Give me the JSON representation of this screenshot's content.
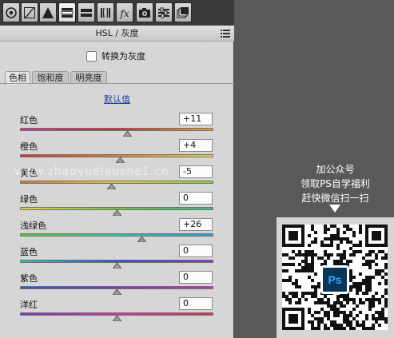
{
  "toolbar": {
    "tools": [
      {
        "icon": "basic-adjust-icon"
      },
      {
        "icon": "tone-curve-icon"
      },
      {
        "icon": "detail-sharpen-icon"
      },
      {
        "icon": "hsl-icon"
      },
      {
        "icon": "split-toning-icon"
      },
      {
        "icon": "lens-correction-icon"
      },
      {
        "icon": "effects-fx-icon",
        "glyph": "fx"
      },
      {
        "icon": "camera-calibration-icon"
      },
      {
        "icon": "presets-icon"
      },
      {
        "icon": "snapshots-icon"
      }
    ],
    "active_index": 3
  },
  "panel": {
    "title": "HSL / 灰度",
    "convert_gray_label": "转换为灰度",
    "tabs": [
      {
        "label": "色相"
      },
      {
        "label": "饱和度"
      },
      {
        "label": "明亮度"
      }
    ],
    "default_link": "默认值"
  },
  "sliders": [
    {
      "label": "红色",
      "value": "+11",
      "numeric": 11,
      "colors": [
        "#d8309a",
        "#cf2e2e",
        "#e8a22a"
      ]
    },
    {
      "label": "橙色",
      "value": "+4",
      "numeric": 4,
      "colors": [
        "#d83030",
        "#e27c28",
        "#e8da30"
      ]
    },
    {
      "label": "黄色",
      "value": "-5",
      "numeric": -5,
      "colors": [
        "#e07428",
        "#e8d02e",
        "#8dd032"
      ]
    },
    {
      "label": "绿色",
      "value": "0",
      "numeric": 0,
      "colors": [
        "#e8d830",
        "#6acc34",
        "#2ec07a"
      ]
    },
    {
      "label": "浅绿色",
      "value": "+26",
      "numeric": 26,
      "colors": [
        "#52c438",
        "#2ec2a4",
        "#2e9ad4"
      ]
    },
    {
      "label": "蓝色",
      "value": "0",
      "numeric": 0,
      "colors": [
        "#2ec4b8",
        "#2e4fd4",
        "#8a36cc"
      ]
    },
    {
      "label": "紫色",
      "value": "0",
      "numeric": 0,
      "colors": [
        "#2e58d4",
        "#7a36cc",
        "#cc30a8"
      ]
    },
    {
      "label": "洋红",
      "value": "0",
      "numeric": 0,
      "colors": [
        "#7b36cc",
        "#d430a6",
        "#d83048"
      ]
    }
  ],
  "slider_range": [
    -100,
    100
  ],
  "watermark": "www.zhaoyuelaushe1.cn",
  "promo": {
    "lines": [
      "加公众号",
      "领取PS自学福利",
      "赶快微信扫一扫"
    ],
    "badge": "Ps"
  }
}
